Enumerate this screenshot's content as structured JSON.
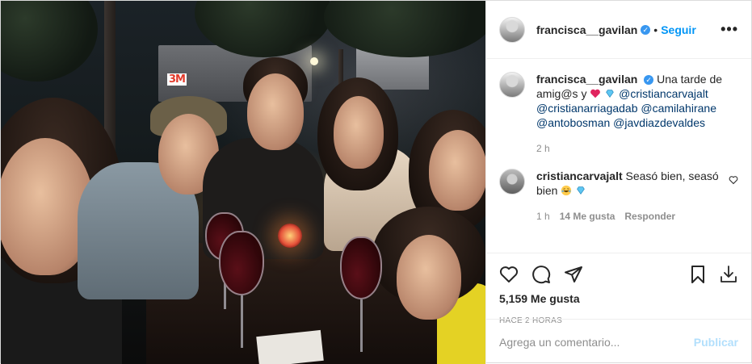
{
  "header": {
    "username": "francisca__gavilan",
    "separator": "•",
    "follow_label": "Seguir",
    "more_icon": "more-options-icon"
  },
  "caption": {
    "username": "francisca__gavilan",
    "text_before": "Una tarde de amig@s y",
    "mentions": [
      "@cristiancarvajalt",
      "@cristianarriagadab",
      "@camilahirane",
      "@antobosman",
      "@javdiazdevaldes"
    ],
    "time": "2 h"
  },
  "comment": {
    "username": "cristiancarvajalt",
    "text": "Seasó bien, seasó bien",
    "time": "1 h",
    "likes": "14 Me gusta",
    "reply_label": "Responder"
  },
  "actions": {
    "likes": "5,159 Me gusta",
    "posted_ago": "HACE 2 HORAS"
  },
  "add_comment": {
    "placeholder": "Agrega un comentario...",
    "publish_label": "Publicar"
  },
  "photo": {
    "sign_text": "3M"
  },
  "colors": {
    "link": "#0095f6",
    "mention": "#00376b",
    "muted": "#8e8e8e",
    "verified": "#3897f0",
    "publish_disabled": "#b2dffc"
  }
}
